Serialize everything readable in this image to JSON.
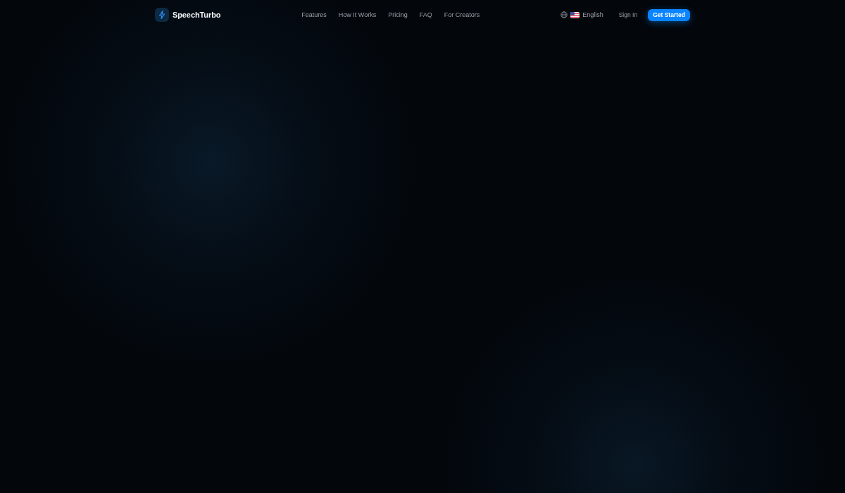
{
  "header": {
    "brand": "SpeechTurbo",
    "nav": [
      "Features",
      "How It Works",
      "Pricing",
      "FAQ",
      "For Creators"
    ],
    "language": {
      "label": "English"
    },
    "sign_in": "Sign In",
    "cta": "Get Started"
  }
}
